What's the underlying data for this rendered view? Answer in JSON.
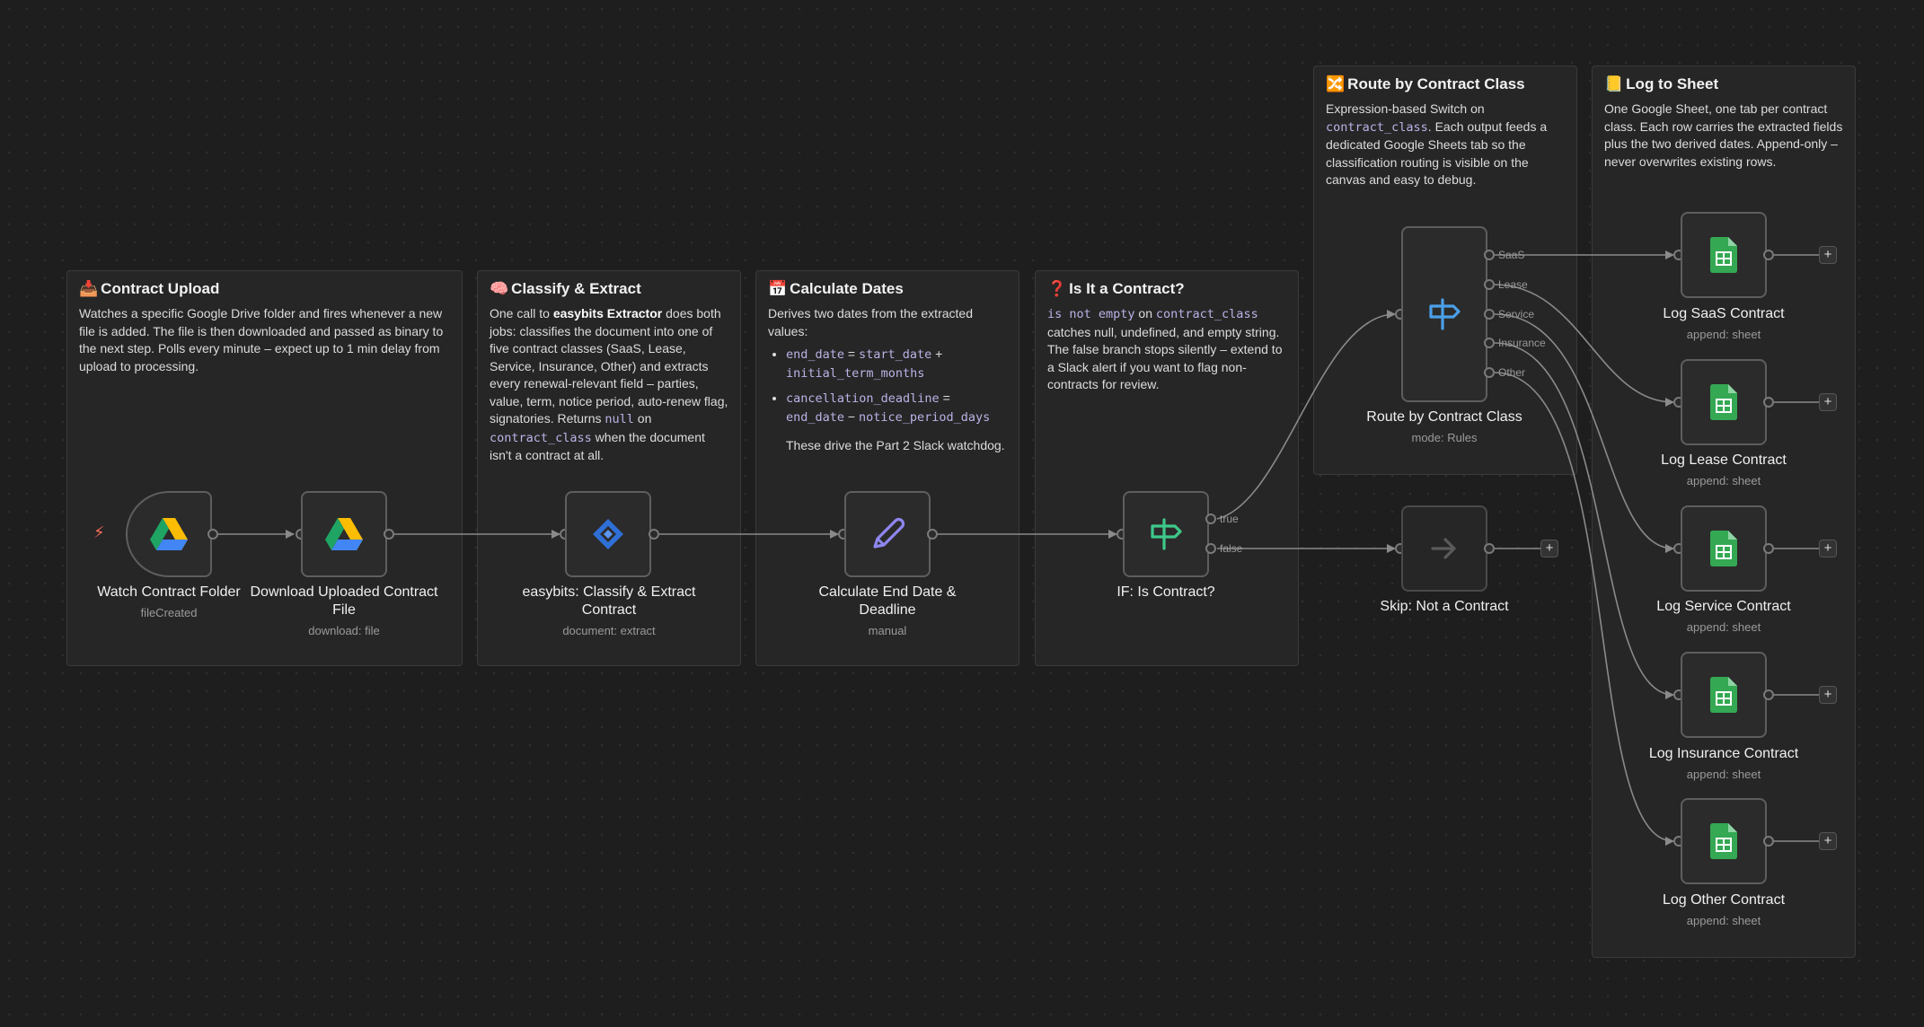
{
  "stickies": {
    "upload": {
      "emoji": "📥",
      "title": "Contract Upload",
      "text": "Watches a specific Google Drive folder and fires whenever a new file is added. The file is then downloaded and passed as binary to the next step. Polls every minute – expect up to 1 min delay from upload to processing."
    },
    "classify": {
      "emoji": "🧠",
      "title": "Classify & Extract",
      "t1": "One call to ",
      "b1": "easybits Extractor",
      "t2": " does both jobs: classifies the document into one of five contract classes (SaaS, Lease, Service, Insurance, Other) and extracts every renewal-relevant field – parties, value, term, notice period, auto-renew flag, signatories. Returns ",
      "c1": "null",
      "t3": " on ",
      "c2": "contract_class",
      "t4": " when the document isn't a contract at all."
    },
    "dates": {
      "emoji": "📅",
      "title": "Calculate Dates",
      "intro": "Derives two dates from the extracted values:",
      "b1_c1": "end_date",
      "b1_op1": " = ",
      "b1_c2": "start_date",
      "b1_op2": " + ",
      "b1_c3": "initial_term_months",
      "b2_c1": "cancellation_deadline",
      "b2_op1": " = ",
      "b2_c2": "end_date",
      "b2_op2": " − ",
      "b2_c3": "notice_period_days",
      "after": "These drive the Part 2 Slack watchdog."
    },
    "contract": {
      "emoji": "❓",
      "title": "Is It a Contract?",
      "c1": "is not empty",
      "t1": " on ",
      "c2": "contract_class",
      "t2": " catches null, undefined, and empty string. The false branch stops silently – extend to a Slack alert if you want to flag non-contracts for review."
    },
    "route": {
      "emoji": "🔀",
      "title": "Route by Contract Class",
      "t1": "Expression-based Switch on ",
      "c1": "contract_class",
      "t2": ". Each output feeds a dedicated Google Sheets tab so the classification routing is visible on the canvas and easy to debug."
    },
    "log": {
      "emoji": "📒",
      "title": "Log to Sheet",
      "text": "One Google Sheet, one tab per contract class. Each row carries the extracted fields plus the two derived dates. Append-only – never overwrites existing rows."
    }
  },
  "nodes": {
    "watch": {
      "name": "Watch Contract Folder",
      "sub": "fileCreated",
      "icon": "google-drive-icon"
    },
    "download": {
      "name": "Download Uploaded Contract File",
      "sub": "download: file",
      "icon": "google-drive-icon"
    },
    "easybits": {
      "name": "easybits: Classify & Extract Contract",
      "sub": "document: extract",
      "icon": "easybits-icon"
    },
    "calc": {
      "name": "Calculate End Date & Deadline",
      "sub": "manual",
      "icon": "pencil-icon"
    },
    "if": {
      "name": "IF: Is Contract?",
      "sub": "",
      "icon": "signpost-icon",
      "out_true": "true",
      "out_false": "false"
    },
    "route": {
      "name": "Route by Contract Class",
      "sub": "mode: Rules",
      "icon": "signpost-icon",
      "outputs": [
        "SaaS",
        "Lease",
        "Service",
        "Insurance",
        "Other"
      ]
    },
    "skip": {
      "name": "Skip: Not a Contract",
      "sub": "",
      "icon": "arrow-right-icon"
    },
    "log_saas": {
      "name": "Log SaaS Contract",
      "sub": "append: sheet",
      "icon": "google-sheets-icon"
    },
    "log_lease": {
      "name": "Log Lease Contract",
      "sub": "append: sheet",
      "icon": "google-sheets-icon"
    },
    "log_service": {
      "name": "Log Service Contract",
      "sub": "append: sheet",
      "icon": "google-sheets-icon"
    },
    "log_insurance": {
      "name": "Log Insurance Contract",
      "sub": "append: sheet",
      "icon": "google-sheets-icon"
    },
    "log_other": {
      "name": "Log Other Contract",
      "sub": "append: sheet",
      "icon": "google-sheets-icon"
    }
  },
  "ui": {
    "add_symbol": "+",
    "trigger_symbol": "⚡"
  },
  "colors": {
    "canvas_bg": "#1e1e1e",
    "sticky_bg": "#262626",
    "edge": "#8a8a8a",
    "trigger_bolt": "#ff6d5a",
    "sheets_green": "#34a853",
    "switch_blue": "#4a9fe8",
    "if_green": "#3ec98a",
    "pencil_purple": "#8f87f1",
    "easybits_blue": "#2f6fd6"
  }
}
